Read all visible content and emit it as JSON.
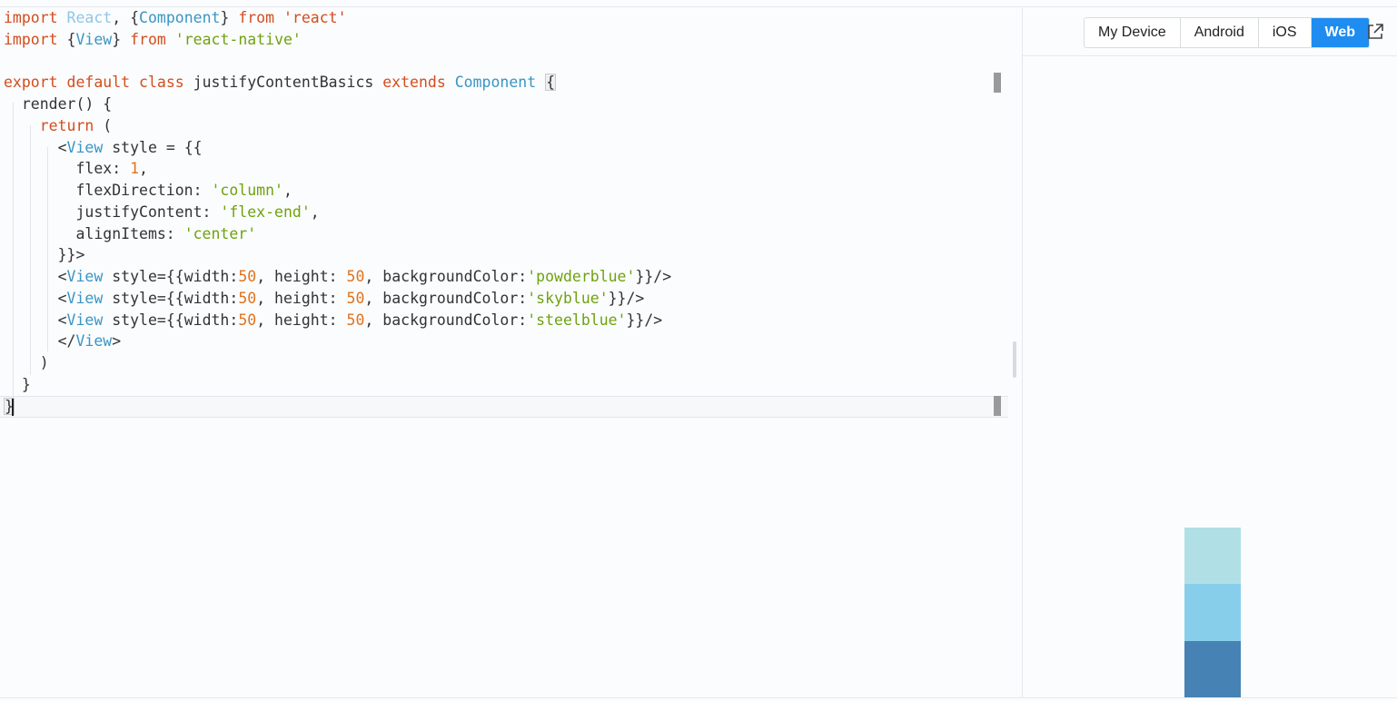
{
  "editor": {
    "lines": [
      [
        {
          "t": "import",
          "c": "kw"
        },
        {
          "t": " "
        },
        {
          "t": "React",
          "c": "dim"
        },
        {
          "t": ", {"
        },
        {
          "t": "Component",
          "c": "cls"
        },
        {
          "t": "} "
        },
        {
          "t": "from",
          "c": "kw"
        },
        {
          "t": " "
        },
        {
          "t": "'react'",
          "c": "kw"
        }
      ],
      [
        {
          "t": "import",
          "c": "kw"
        },
        {
          "t": " {"
        },
        {
          "t": "View",
          "c": "cls"
        },
        {
          "t": "} "
        },
        {
          "t": "from",
          "c": "kw"
        },
        {
          "t": " "
        },
        {
          "t": "'react-native'",
          "c": "str"
        }
      ],
      [],
      [
        {
          "t": "export",
          "c": "kw"
        },
        {
          "t": " "
        },
        {
          "t": "default",
          "c": "kw"
        },
        {
          "t": " "
        },
        {
          "t": "class",
          "c": "kw"
        },
        {
          "t": " justifyContentBasics "
        },
        {
          "t": "extends",
          "c": "kw"
        },
        {
          "t": " "
        },
        {
          "t": "Component",
          "c": "cls"
        },
        {
          "t": " "
        },
        {
          "t": "{",
          "c": "box"
        }
      ],
      [
        {
          "t": "  render() {"
        }
      ],
      [
        {
          "t": "    "
        },
        {
          "t": "return",
          "c": "kw"
        },
        {
          "t": " ("
        }
      ],
      [
        {
          "t": "      <"
        },
        {
          "t": "View",
          "c": "cls"
        },
        {
          "t": " style = {{"
        }
      ],
      [
        {
          "t": "        flex: "
        },
        {
          "t": "1",
          "c": "num"
        },
        {
          "t": ","
        }
      ],
      [
        {
          "t": "        flexDirection: "
        },
        {
          "t": "'column'",
          "c": "str"
        },
        {
          "t": ","
        }
      ],
      [
        {
          "t": "        justifyContent: "
        },
        {
          "t": "'flex-end'",
          "c": "str"
        },
        {
          "t": ","
        }
      ],
      [
        {
          "t": "        alignItems: "
        },
        {
          "t": "'center'",
          "c": "str"
        }
      ],
      [
        {
          "t": "      }}>"
        }
      ],
      [
        {
          "t": "      <"
        },
        {
          "t": "View",
          "c": "cls"
        },
        {
          "t": " style={{width:"
        },
        {
          "t": "50",
          "c": "num"
        },
        {
          "t": ", height: "
        },
        {
          "t": "50",
          "c": "num"
        },
        {
          "t": ", backgroundColor:"
        },
        {
          "t": "'powderblue'",
          "c": "str"
        },
        {
          "t": "}}/>"
        }
      ],
      [
        {
          "t": "      <"
        },
        {
          "t": "View",
          "c": "cls"
        },
        {
          "t": " style={{width:"
        },
        {
          "t": "50",
          "c": "num"
        },
        {
          "t": ", height: "
        },
        {
          "t": "50",
          "c": "num"
        },
        {
          "t": ", backgroundColor:"
        },
        {
          "t": "'skyblue'",
          "c": "str"
        },
        {
          "t": "}}/>"
        }
      ],
      [
        {
          "t": "      <"
        },
        {
          "t": "View",
          "c": "cls"
        },
        {
          "t": " style={{width:"
        },
        {
          "t": "50",
          "c": "num"
        },
        {
          "t": ", height: "
        },
        {
          "t": "50",
          "c": "num"
        },
        {
          "t": ", backgroundColor:"
        },
        {
          "t": "'steelblue'",
          "c": "str"
        },
        {
          "t": "}}/>"
        }
      ],
      [
        {
          "t": "      </"
        },
        {
          "t": "View",
          "c": "cls"
        },
        {
          "t": ">"
        }
      ],
      [
        {
          "t": "    )"
        }
      ],
      [
        {
          "t": "  }"
        }
      ],
      [
        {
          "t": "}",
          "c": "box"
        }
      ]
    ]
  },
  "device_tabs": {
    "items": [
      {
        "label": "My Device",
        "active": false
      },
      {
        "label": "Android",
        "active": false
      },
      {
        "label": "iOS",
        "active": false
      },
      {
        "label": "Web",
        "active": true
      }
    ]
  },
  "toolbar": {
    "open_external_icon": "external-link-icon"
  },
  "preview": {
    "boxes": [
      {
        "name": "powderblue",
        "color": "#b0e0e6"
      },
      {
        "name": "skyblue",
        "color": "#87ceeb"
      },
      {
        "name": "steelblue",
        "color": "#4682b4"
      }
    ]
  },
  "colors": {
    "keyword": "#d34d1e",
    "type": "#3a95c4",
    "string": "#6fa20e",
    "number": "#e0731e",
    "active_tab": "#1e8cf0"
  }
}
